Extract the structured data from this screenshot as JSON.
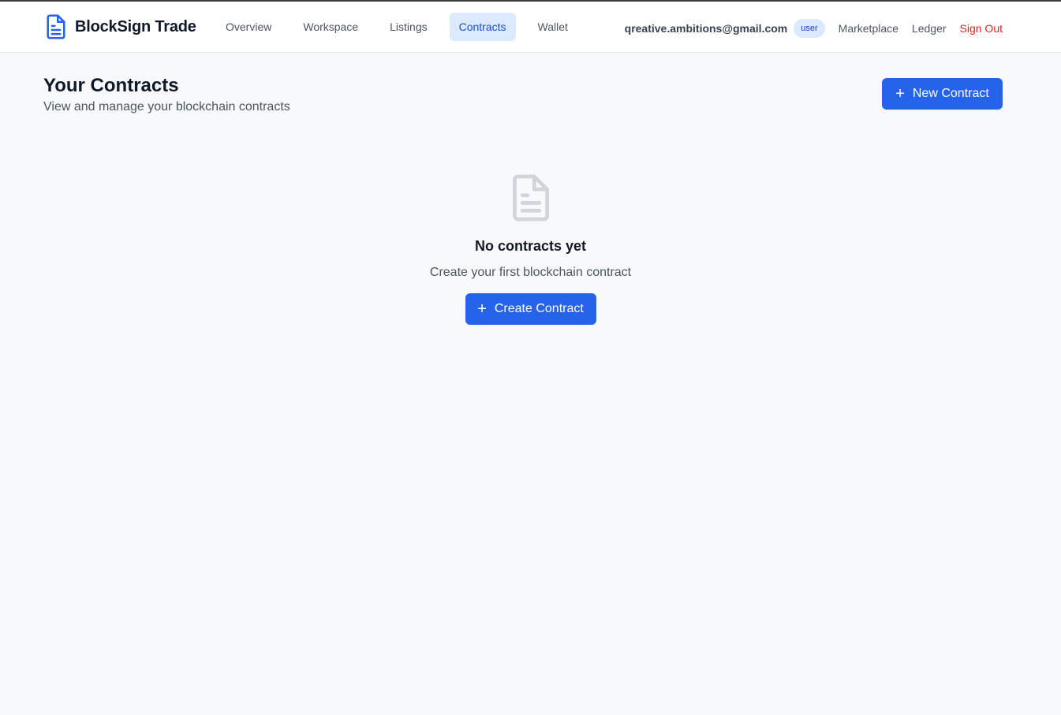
{
  "header": {
    "brand": {
      "name": "BlockSign Trade",
      "icon": "document-icon"
    },
    "nav": [
      {
        "label": "Overview",
        "active": false
      },
      {
        "label": "Workspace",
        "active": false
      },
      {
        "label": "Listings",
        "active": false
      },
      {
        "label": "Contracts",
        "active": true
      },
      {
        "label": "Wallet",
        "active": false
      }
    ],
    "user": {
      "email": "qreative.ambitions@gmail.com",
      "role": "user"
    },
    "links": {
      "marketplace": "Marketplace",
      "ledger": "Ledger",
      "signout": "Sign Out"
    }
  },
  "main": {
    "title": "Your Contracts",
    "subtitle": "View and manage your blockchain contracts",
    "new_button": {
      "icon": "plus-icon",
      "label": "New Contract"
    },
    "empty_state": {
      "icon": "document-icon",
      "title": "No contracts yet",
      "subtitle": "Create your first blockchain contract",
      "button": {
        "icon": "plus-icon",
        "label": "Create Contract"
      }
    }
  },
  "colors": {
    "accent": "#2563eb",
    "active_nav_bg": "#dbeafe",
    "signout": "#dc2626",
    "background": "#f8f9fb"
  }
}
